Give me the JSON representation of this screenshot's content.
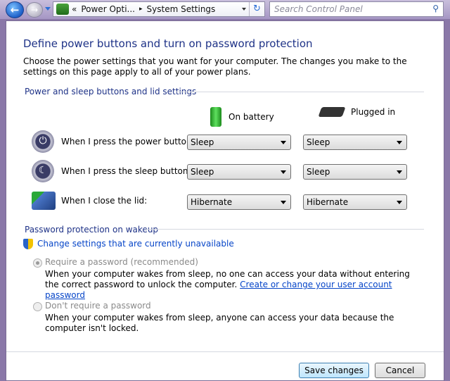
{
  "nav": {
    "breadcrumb": [
      "«",
      "Power Opti...",
      "▸",
      "System Settings"
    ],
    "search_placeholder": "Search Control Panel"
  },
  "title": "Define power buttons and turn on password protection",
  "description": "Choose the power settings that you want for your computer. The changes you make to the settings on this page apply to all of your power plans.",
  "buttons_section": {
    "heading": "Power and sleep buttons and lid settings",
    "col_battery": "On battery",
    "col_plugged": "Plugged in",
    "rows": [
      {
        "label": "When I press the power button:",
        "battery": "Sleep",
        "plugged": "Sleep"
      },
      {
        "label": "When I press the sleep button:",
        "battery": "Sleep",
        "plugged": "Sleep"
      },
      {
        "label": "When I close the lid:",
        "battery": "Hibernate",
        "plugged": "Hibernate"
      }
    ]
  },
  "password_section": {
    "heading": "Password protection on wakeup",
    "change_link": "Change settings that are currently unavailable",
    "require_label": "Require a password (recommended)",
    "require_text": "When your computer wakes from sleep, no one can access your data without entering the correct password to unlock the computer.",
    "require_link": "Create or change your user account password",
    "norequire_label": "Don't require a password",
    "norequire_text": "When your computer wakes from sleep, anyone can access your data because the computer isn't locked.",
    "selected": "require"
  },
  "footer": {
    "save": "Save changes",
    "cancel": "Cancel"
  }
}
